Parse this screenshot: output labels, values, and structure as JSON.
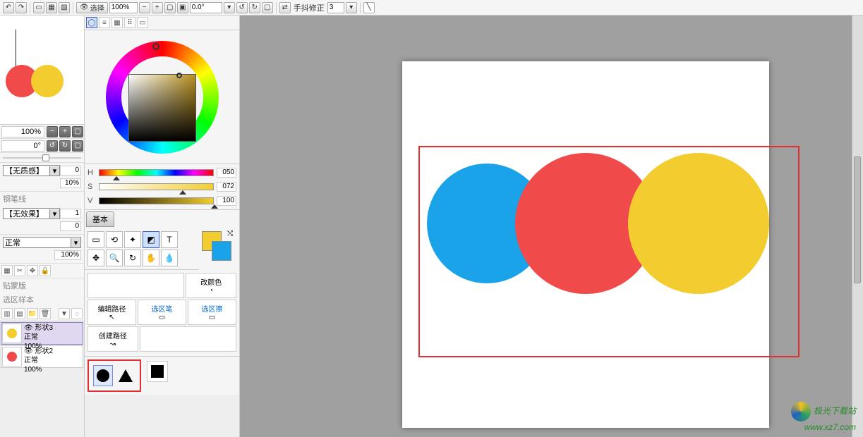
{
  "topbar": {
    "select_label": "选择",
    "zoom_value": "100%",
    "angle_value": "0.0°",
    "stabilizer_label": "手抖修正",
    "stabilizer_value": "3"
  },
  "navigator": {
    "zoom_value": "100%",
    "angle_value": "0°"
  },
  "brush_props": {
    "quality_combo": "【无质感】",
    "quality_val1": "0",
    "quality_val2": "10%",
    "pen_line_label": "钢笔线",
    "effect_combo": "【无效果】",
    "effect_val1": "1",
    "effect_val2": "0"
  },
  "blend": {
    "mode": "正常",
    "opacity": "100%"
  },
  "mask_label": "贴蒙版",
  "style_label": "选区样本",
  "hsv": {
    "h": "050",
    "s": "072",
    "v": "100"
  },
  "palette_tab": "基本",
  "subtools": {
    "change_color": "改颜色",
    "edit_path": "编辑路径",
    "sel_pen": "选区笔",
    "sel_erase": "选区擦",
    "create_path": "创建路径"
  },
  "layers": {
    "item1": {
      "name": "形状3",
      "mode": "正常",
      "opacity": "100%"
    },
    "item2": {
      "name": "形状2",
      "mode": "正常",
      "opacity": "100%"
    }
  },
  "watermark": {
    "line1": "极光下载站",
    "line2": "www.xz7.com"
  },
  "colors": {
    "fg": "#f3cd2f",
    "bg": "#1aa3e8",
    "red": "#f04a4a"
  }
}
